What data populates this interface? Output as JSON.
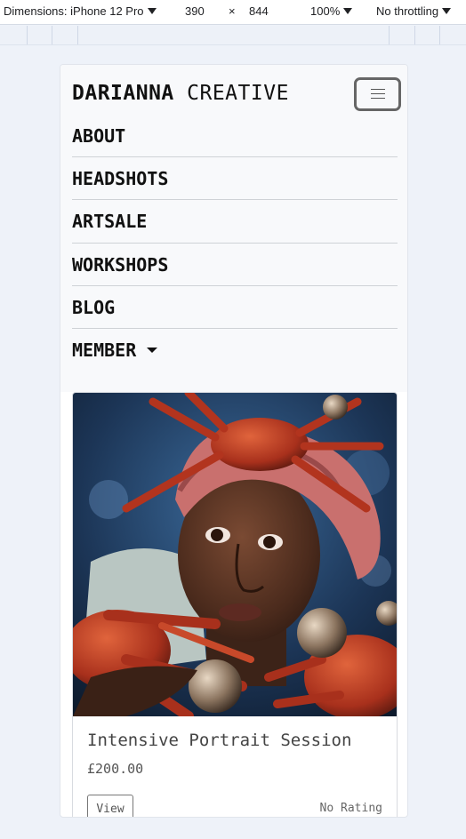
{
  "devtools": {
    "dimensions_label": "Dimensions: iPhone 12 Pro",
    "width": "390",
    "times": "×",
    "height": "844",
    "zoom": "100%",
    "throttling": "No throttling"
  },
  "site": {
    "brand_bold": "DARIANNA",
    "brand_light": "CREATIVE"
  },
  "nav": {
    "items": [
      {
        "label": "ABOUT"
      },
      {
        "label": "HEADSHOTS"
      },
      {
        "label": "ARTSALE"
      },
      {
        "label": "WORKSHOPS"
      },
      {
        "label": "BLOG"
      },
      {
        "label": "MEMBER"
      }
    ]
  },
  "product": {
    "title": "Intensive Portrait Session",
    "price": "£200.00",
    "view_label": "View",
    "rating": "No Rating"
  },
  "colors": {
    "page_background": "#eef2f9",
    "navbar_background": "#f8f9fb",
    "text": "#111111"
  },
  "icons": {
    "menu": "hamburger-icon",
    "dropdown": "caret-down-icon"
  }
}
